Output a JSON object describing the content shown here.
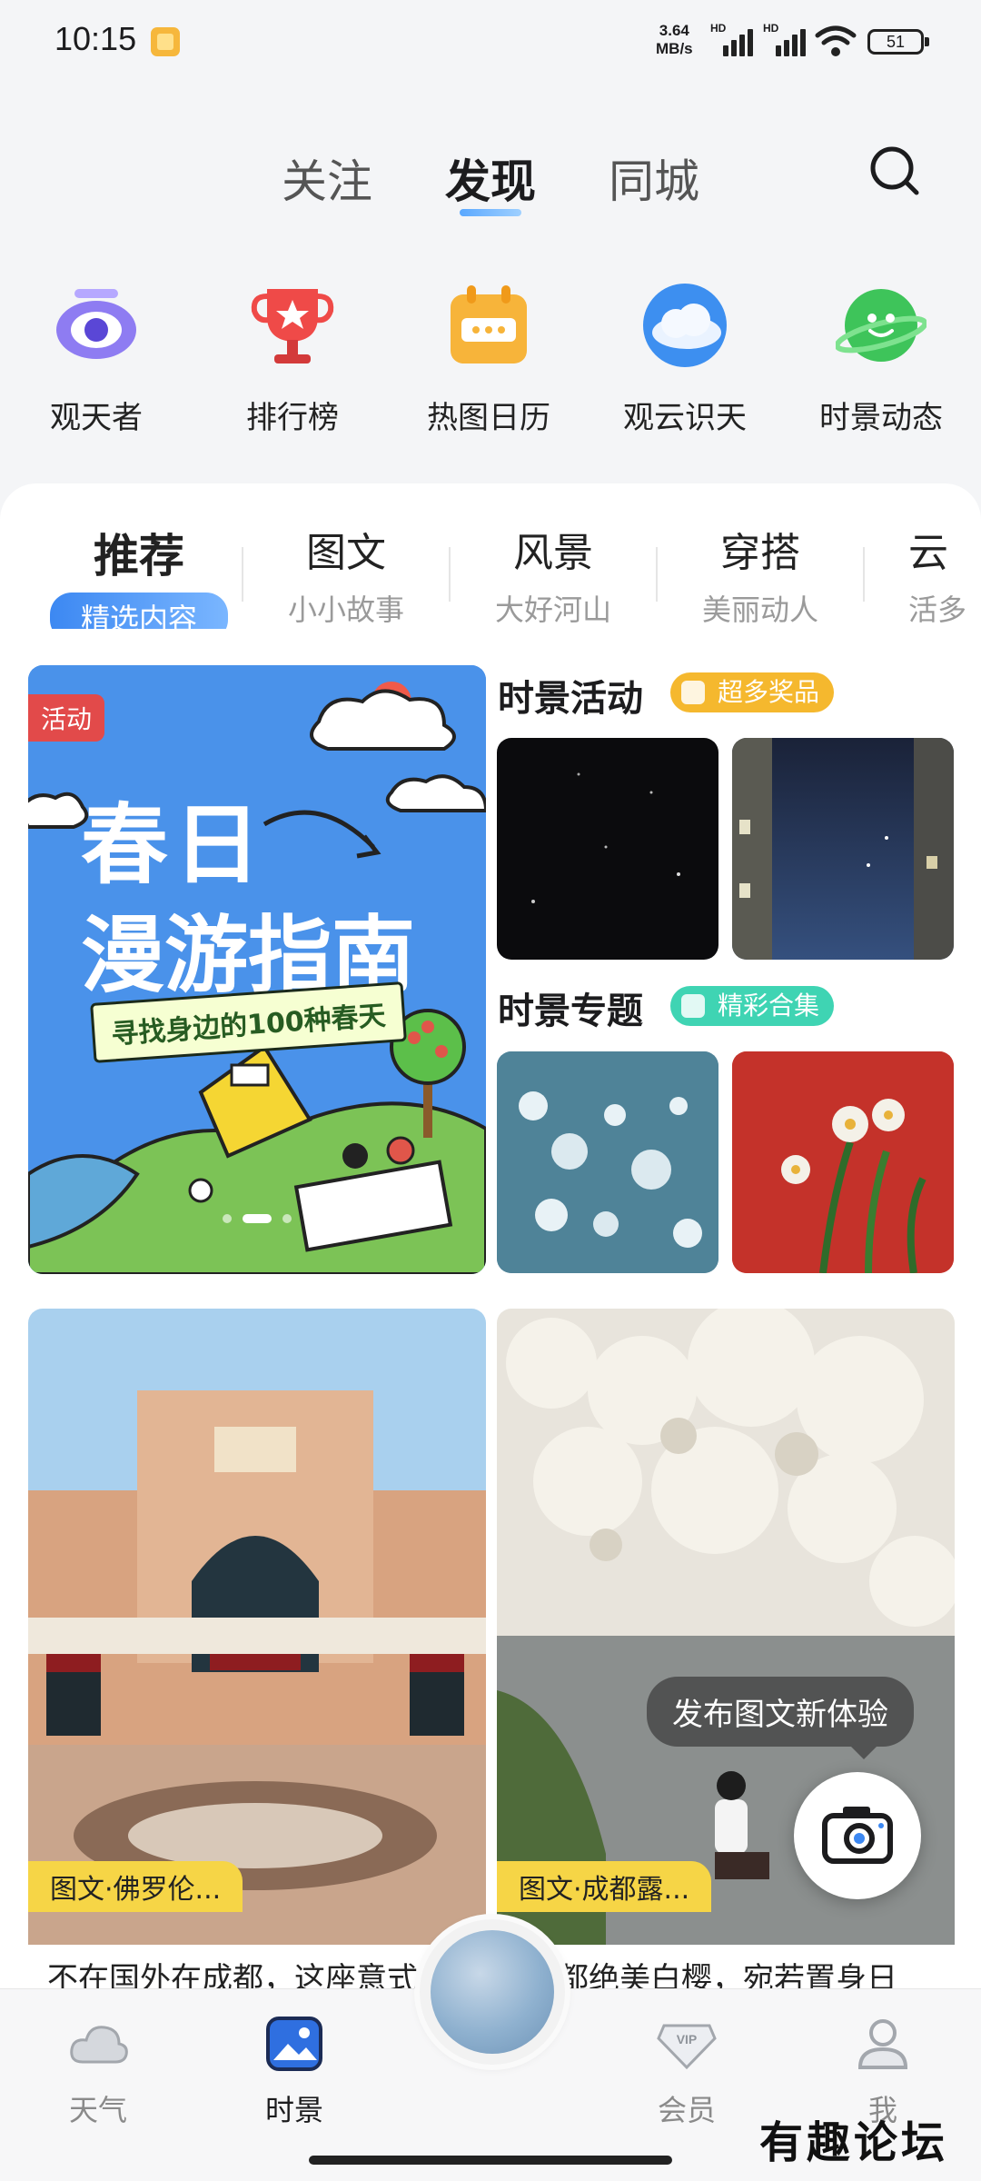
{
  "status_bar": {
    "time": "10:15",
    "net_speed_value": "3.64",
    "net_speed_unit": "MB/s",
    "signal_label": "HD",
    "battery": "51"
  },
  "top_tabs": [
    "关注",
    "发现",
    "同城"
  ],
  "quick_entries": [
    "观天者",
    "排行榜",
    "热图日历",
    "观云识天",
    "时景动态"
  ],
  "categories": [
    {
      "title": "推荐",
      "subtitle": "精选内容"
    },
    {
      "title": "图文",
      "subtitle": "小小故事"
    },
    {
      "title": "风景",
      "subtitle": "大好河山"
    },
    {
      "title": "穿搭",
      "subtitle": "美丽动人"
    },
    {
      "title": "云",
      "subtitle": "活多"
    }
  ],
  "banner": {
    "tag": "活动",
    "line1": "春日",
    "line2": "漫游指南",
    "subtitle": "寻找身边的100种春天"
  },
  "activity_section": {
    "title": "时景活动",
    "badge": "超多奖品",
    "badge_color": "#f5b82e"
  },
  "topic_section": {
    "title": "时景专题",
    "badge": "精彩合集",
    "badge_color": "#3fd4b3"
  },
  "feed": [
    {
      "label": "图文·佛罗伦...",
      "text": "不在国外在成都，这座意式"
    },
    {
      "label": "图文·成都露...",
      "text": "都绝美白樱，宛若置身日"
    }
  ],
  "tooltip": "发布图文新体验",
  "bottom_nav": [
    {
      "label": "天气",
      "icon": "cloud-icon"
    },
    {
      "label": "时景",
      "icon": "image-icon"
    },
    {
      "label": "会员",
      "icon": "vip-icon"
    },
    {
      "label": "我",
      "icon": "user-icon"
    }
  ],
  "watermark": "有趣论坛",
  "colors": {
    "accent": "#3c88f2",
    "label_yellow": "#f6d546"
  }
}
